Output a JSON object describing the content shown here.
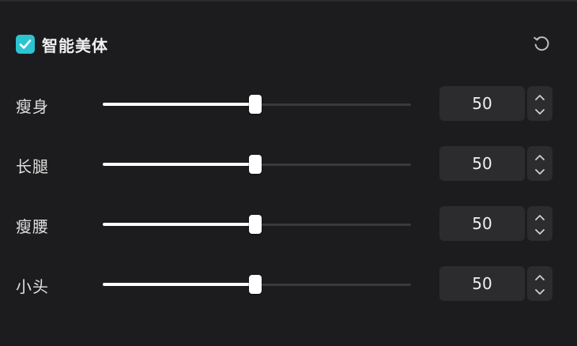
{
  "header": {
    "title": "智能美体",
    "checked": true
  },
  "colors": {
    "accent": "#2bc4d0",
    "panel_bg": "#1c1c1e",
    "control_bg": "#2c2c2e",
    "track": "#3a3a3c",
    "fill": "#ffffff"
  },
  "icons": {
    "checkbox": "checkmark-icon",
    "reset": "reset-icon",
    "stepper_up": "chevron-up-icon",
    "stepper_down": "chevron-down-icon"
  },
  "rows": [
    {
      "label": "瘦身",
      "value": "50",
      "level": 0.5
    },
    {
      "label": "长腿",
      "value": "50",
      "level": 0.5
    },
    {
      "label": "瘦腰",
      "value": "50",
      "level": 0.5
    },
    {
      "label": "小头",
      "value": "50",
      "level": 0.5
    }
  ]
}
